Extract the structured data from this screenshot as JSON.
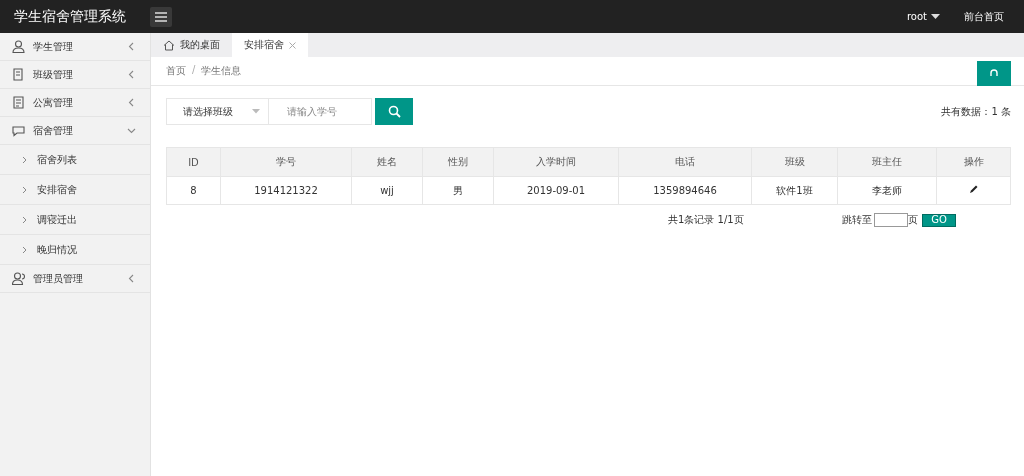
{
  "header": {
    "title": "学生宿舍管理系统",
    "user": "root",
    "home_link": "前台首页"
  },
  "sidebar": {
    "items": [
      {
        "label": "学生管理",
        "kind": "user",
        "expanded": false
      },
      {
        "label": "班级管理",
        "kind": "doc",
        "expanded": false
      },
      {
        "label": "公寓管理",
        "kind": "note",
        "expanded": false
      },
      {
        "label": "宿舍管理",
        "kind": "chat",
        "expanded": true,
        "children": [
          {
            "label": "宿舍列表"
          },
          {
            "label": "安排宿舍"
          },
          {
            "label": "调寝迁出"
          },
          {
            "label": "晚归情况"
          }
        ]
      },
      {
        "label": "管理员管理",
        "kind": "users",
        "expanded": false
      }
    ]
  },
  "tabs": [
    {
      "label": "我的桌面",
      "kind": "home",
      "selected": false
    },
    {
      "label": "安排宿舍",
      "kind": "closable",
      "selected": true
    }
  ],
  "breadcrumb": {
    "items": [
      "首页",
      "学生信息"
    ],
    "separator": "/"
  },
  "search": {
    "select_placeholder": "请选择班级",
    "input_placeholder": "请输入学号"
  },
  "total": "共有数据：1 条",
  "table": {
    "columns": [
      "ID",
      "学号",
      "姓名",
      "性别",
      "入学时间",
      "电话",
      "班级",
      "班主任",
      "操作"
    ],
    "rows": [
      [
        "8",
        "1914121322",
        "wjj",
        "男",
        "2019-09-01",
        "1359894646",
        "软件1班",
        "李老师"
      ]
    ]
  },
  "pagination": {
    "summary": "共1条记录  1/1页",
    "jump_label": "跳转至",
    "page_unit": "页",
    "go": "GO"
  }
}
